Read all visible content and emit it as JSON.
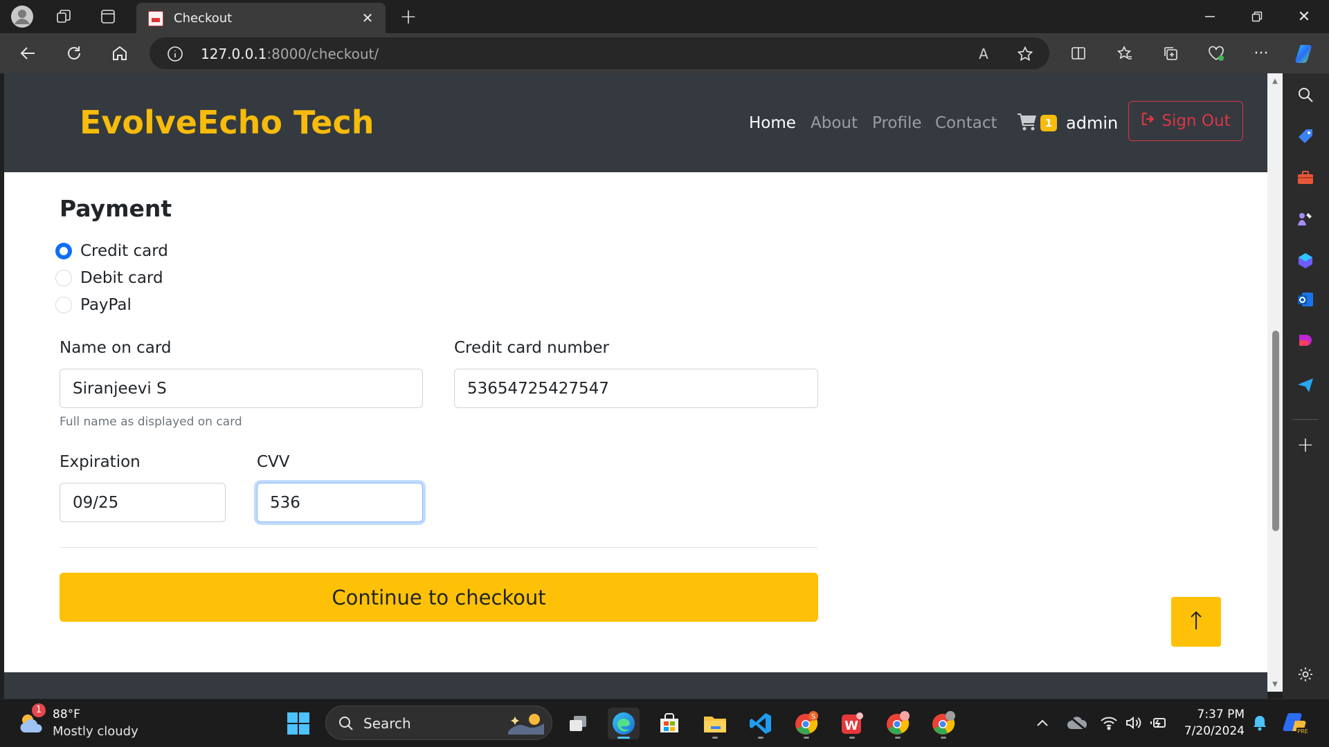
{
  "browser": {
    "tab_title": "Checkout",
    "url_host": "127.0.0.1",
    "url_rest": ":8000/checkout/"
  },
  "navbar": {
    "brand": "EvolveEcho Tech",
    "links": [
      "Home",
      "About",
      "Profile",
      "Contact"
    ],
    "active_link": "Home",
    "cart_count": "1",
    "username": "admin",
    "signout_label": "Sign Out"
  },
  "payment": {
    "heading": "Payment",
    "methods": [
      "Credit card",
      "Debit card",
      "PayPal"
    ],
    "selected_method": "Credit card",
    "name_label": "Name on card",
    "name_value": "Siranjeevi S",
    "name_help": "Full name as displayed on card",
    "number_label": "Credit card number",
    "number_value": "53654725427547",
    "expiration_label": "Expiration",
    "expiration_value": "09/25",
    "cvv_label": "CVV",
    "cvv_value": "536",
    "checkout_label": "Continue to checkout",
    "back_to_top_icon": "arrow-up-icon"
  },
  "taskbar": {
    "weather_badge": "1",
    "weather_temp": "88°F",
    "weather_desc": "Mostly cloudy",
    "search_placeholder": "Search",
    "time": "7:37 PM",
    "date": "7/20/2024"
  },
  "colors": {
    "brand": "#f7bb0c",
    "navbar_bg": "#343a40",
    "primary_button": "#ffc107",
    "danger": "#dc3545",
    "radio_checked": "#0d6efd"
  }
}
